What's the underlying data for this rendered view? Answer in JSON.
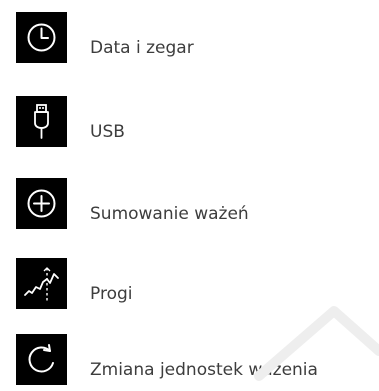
{
  "menu": {
    "items": [
      {
        "label": "Data i zegar",
        "icon": "clock-icon"
      },
      {
        "label": "USB",
        "icon": "usb-icon"
      },
      {
        "label": "Sumowanie ważeń",
        "icon": "plus-circle-icon"
      },
      {
        "label": "Progi",
        "icon": "thresholds-chart-icon"
      },
      {
        "label": "Zmiana jednostek ważenia",
        "icon": "refresh-icon"
      }
    ]
  },
  "colors": {
    "icon_background": "#000000",
    "icon_stroke": "#ffffff",
    "label_text": "#3d3d3d",
    "watermark": "#eeeeee"
  }
}
